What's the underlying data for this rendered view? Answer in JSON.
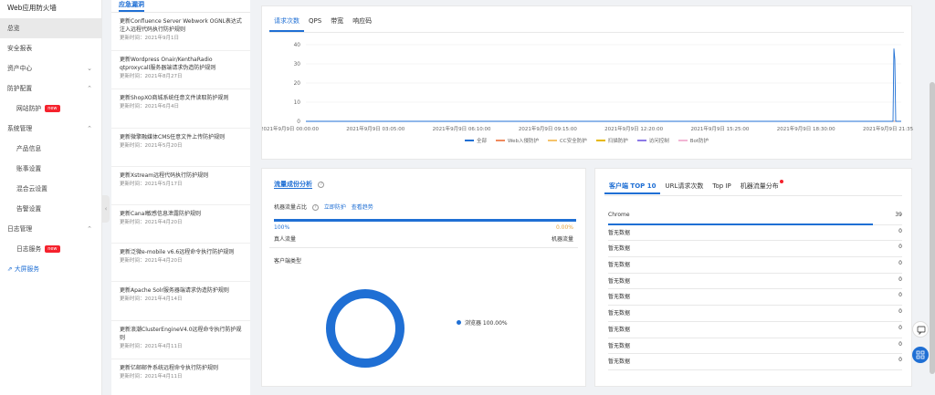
{
  "sidebar": {
    "brand": "Web应用防火墙",
    "items": [
      {
        "label": "总览",
        "active": true
      },
      {
        "label": "安全报表"
      },
      {
        "label": "资产中心",
        "chevron": "chevron-down"
      },
      {
        "label": "防护配置",
        "chevron": "chevron-up"
      },
      {
        "label": "网站防护",
        "sub": true,
        "badge": "new"
      },
      {
        "label": "系统管理",
        "chevron": "chevron-up"
      },
      {
        "label": "产品信息",
        "sub": true
      },
      {
        "label": "账事设置",
        "sub": true
      },
      {
        "label": "混合云设置",
        "sub": true
      },
      {
        "label": "告警设置",
        "sub": true
      },
      {
        "label": "日志管理",
        "chevron": "chevron-up"
      },
      {
        "label": "日志服务",
        "sub": true,
        "badge": "new"
      },
      {
        "label": "⇗ 大屏服务",
        "link": true
      }
    ]
  },
  "alerts": {
    "title": "应急漏洞",
    "items": [
      {
        "title": "更新Confluence Server Webwork OGNL表达式注入远程代码执行防护规则",
        "date": "更新时间：2021年9月1日"
      },
      {
        "title": "更新Wordpress Onair/KenthaRadio qtproxycall服务器端请求伪造防护规则",
        "date": "更新时间：2021年8月27日"
      },
      {
        "title": "更新ShopXO商城系统任意文件读取防护规则",
        "date": "更新时间：2021年6月4日"
      },
      {
        "title": "更新微擎融媒体CMS任意文件上传防护规则",
        "date": "更新时间：2021年5月20日"
      },
      {
        "title": "更新Xstream远程代码执行防护规则",
        "date": "更新时间：2021年5月17日"
      },
      {
        "title": "更新Canal敏感信息泄露防护规则",
        "date": "更新时间：2021年4月20日"
      },
      {
        "title": "更新泛微e-mobile v6.6远程命令执行防护规则",
        "date": "更新时间：2021年4月20日"
      },
      {
        "title": "更新Apache Solr服务器端请求伪造防护规则",
        "date": "更新时间：2021年4月14日"
      },
      {
        "title": "更新浪潮ClusterEngineV4.0远程命令执行防护规则",
        "date": "更新时间：2021年4月11日"
      },
      {
        "title": "更新亿邮邮件系统远程命令执行防护规则",
        "date": "更新时间：2021年4月11日"
      }
    ]
  },
  "top_panel": {
    "tabs": [
      "请求次数",
      "QPS",
      "带宽",
      "响应码"
    ],
    "active_tab": 0,
    "legend": [
      {
        "label": "全部",
        "color": "#1f6fd4"
      },
      {
        "label": "Web入侵防护",
        "color": "#f08a5d"
      },
      {
        "label": "CC安全防护",
        "color": "#f5c36b"
      },
      {
        "label": "扫描防护",
        "color": "#e6b800"
      },
      {
        "label": "访问控制",
        "color": "#8c7ae6"
      },
      {
        "label": "Bot防护",
        "color": "#f2b5d4"
      }
    ]
  },
  "chart_data": {
    "type": "line",
    "x": [
      "2021年9月9日 00:00:00",
      "2021年9月9日 03:05:00",
      "2021年9月9日 06:10:00",
      "2021年9月9日 09:15:00",
      "2021年9月9日 12:20:00",
      "2021年9月9日 15:25:00",
      "2021年9月9日 18:30:00",
      "2021年9月9日 21:35:00"
    ],
    "ylim": [
      0,
      40
    ],
    "yticks": [
      0,
      10,
      20,
      30,
      40
    ],
    "series": [
      {
        "name": "全部",
        "color": "#1f6fd4",
        "spike_at": "2021年9月9日 21:35:00",
        "peak": 38
      },
      {
        "name": "Web入侵防护",
        "color": "#f08a5d",
        "values": [
          0,
          0,
          0,
          0,
          0,
          0,
          0,
          0
        ]
      }
    ]
  },
  "flow": {
    "title": "流量成份分析",
    "bot_label": "机器流量占比",
    "link1": "立即防护",
    "link2": "查看趋势",
    "left_pct": "100%",
    "right_pct": "0.00%",
    "left_label": "真人流量",
    "right_label": "机器流量",
    "client_type": "客户端类型",
    "donut_label": "浏览器 100.00%",
    "human_share": 1.0
  },
  "top10": {
    "tabs": [
      "客户端 TOP 10",
      "URL请求次数",
      "Top IP",
      "机器流量分布"
    ],
    "rows": [
      {
        "name": "Chrome",
        "value": "39",
        "fill": 0.9
      },
      {
        "name": "暂无数据",
        "value": "0",
        "fill": 0
      },
      {
        "name": "暂无数据",
        "value": "0",
        "fill": 0
      },
      {
        "name": "暂无数据",
        "value": "0",
        "fill": 0
      },
      {
        "name": "暂无数据",
        "value": "0",
        "fill": 0
      },
      {
        "name": "暂无数据",
        "value": "0",
        "fill": 0
      },
      {
        "name": "暂无数据",
        "value": "0",
        "fill": 0
      },
      {
        "name": "暂无数据",
        "value": "0",
        "fill": 0
      },
      {
        "name": "暂无数据",
        "value": "0",
        "fill": 0
      },
      {
        "name": "暂无数据",
        "value": "0",
        "fill": 0
      }
    ]
  }
}
